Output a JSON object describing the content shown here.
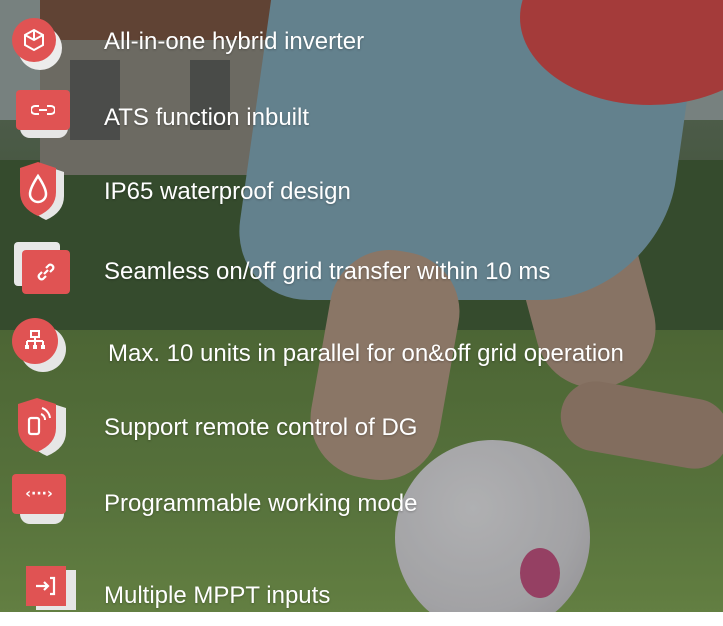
{
  "colors": {
    "accent": "#e05353",
    "accent_dark": "#b93a3a",
    "text": "#ffffff"
  },
  "features": [
    {
      "label": "All-in-one hybrid inverter",
      "icon": "cube-icon"
    },
    {
      "label": "ATS function inbuilt",
      "icon": "link-icon"
    },
    {
      "label": "IP65 waterproof design",
      "icon": "water-drop-icon"
    },
    {
      "label": "Seamless on/off grid transfer within 10 ms",
      "icon": "chain-link-icon"
    },
    {
      "label": "Max. 10 units in parallel for on&off grid operation",
      "icon": "network-icon"
    },
    {
      "label": "Support remote control of DG",
      "icon": "remote-signal-icon"
    },
    {
      "label": "Programmable working mode",
      "icon": "code-icon"
    },
    {
      "label": "Multiple MPPT inputs",
      "icon": "input-arrow-icon"
    }
  ]
}
